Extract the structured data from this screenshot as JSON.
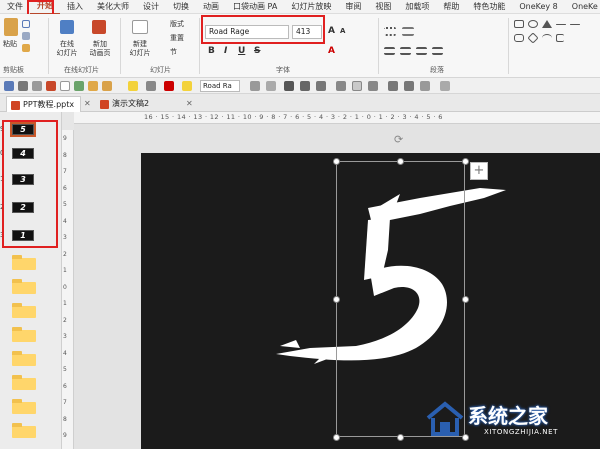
{
  "ribbon_tabs": [
    "文件",
    "开始",
    "插入",
    "美化大师",
    "设计",
    "切换",
    "动画",
    "口袋动画 PA",
    "幻灯片放映",
    "审阅",
    "视图",
    "加载项",
    "帮助",
    "特色功能",
    "OneKey 8",
    "OneKe"
  ],
  "active_tab": "开始",
  "clipboard": {
    "paste": "粘贴",
    "label": "剪贴板"
  },
  "online_slides": {
    "online": "在线",
    "online_sub": "幻灯片",
    "new_anim": "新加",
    "new_anim_sub": "动画页",
    "label": "在线幻灯片"
  },
  "slides_group": {
    "new": "新建",
    "new_sub": "幻灯片",
    "layout": "版式",
    "reset": "重置",
    "section": "节",
    "label": "幻灯片"
  },
  "font": {
    "name": "Road Rage",
    "size": "413",
    "label": "字体"
  },
  "paragraph": {
    "label": "段落"
  },
  "quickbar_font": "Road Ra",
  "doc_tabs": [
    {
      "name": "PPT教程.pptx",
      "active": true
    },
    {
      "name": "演示文稿2",
      "active": false
    }
  ],
  "thumbnails": [
    {
      "num": "9",
      "label": "5",
      "selected": true
    },
    {
      "num": "0",
      "label": "4",
      "selected": false
    },
    {
      "num": "1",
      "label": "3",
      "selected": false
    },
    {
      "num": "2",
      "label": "2",
      "selected": false
    },
    {
      "num": "3",
      "label": "1",
      "selected": false
    }
  ],
  "hruler_text": "16 · 15 · 14 · 13 · 12 · 11 · 10 · 9 · 8 · 7 · 6 · 5 · 4 · 3 · 2 · 1 · 0 · 1 · 2 · 3 · 4 · 5 · 6",
  "vruler_ticks": [
    "9",
    "8",
    "7",
    "6",
    "5",
    "4",
    "3",
    "2",
    "1",
    "0",
    "1",
    "2",
    "3",
    "4",
    "5",
    "6",
    "7",
    "8",
    "9"
  ],
  "slide_text": "5",
  "watermark": {
    "title": "系统之家",
    "url": "XITONGZHIJIA.NET"
  },
  "colors": {
    "accent": "#b7472a",
    "highlight_box": "#e02020",
    "slide_bg": "#1b1b1b"
  }
}
